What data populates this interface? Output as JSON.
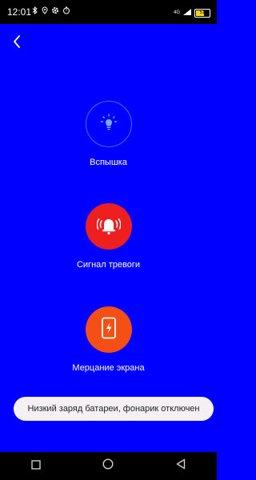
{
  "status_bar": {
    "time": "12:01",
    "network_label": "4G",
    "battery_label": "51"
  },
  "icons": {
    "back": "chevron-left-icon",
    "flash": "lightbulb-icon",
    "alarm": "alarm-bell-icon",
    "screen_flicker": "phone-lightning-icon"
  },
  "features": {
    "flash_label": "Вспышка",
    "alarm_label": "Сигнал тревоги",
    "screen_flicker_label": "Мерцание экрана"
  },
  "toast": {
    "message": "Низкий заряд батареи, фонарик отключен"
  },
  "colors": {
    "background": "#0000ff",
    "alarm": "#ee1f1f",
    "screen_flicker": "#f44f14",
    "flash_outline": "#3f6eff"
  }
}
